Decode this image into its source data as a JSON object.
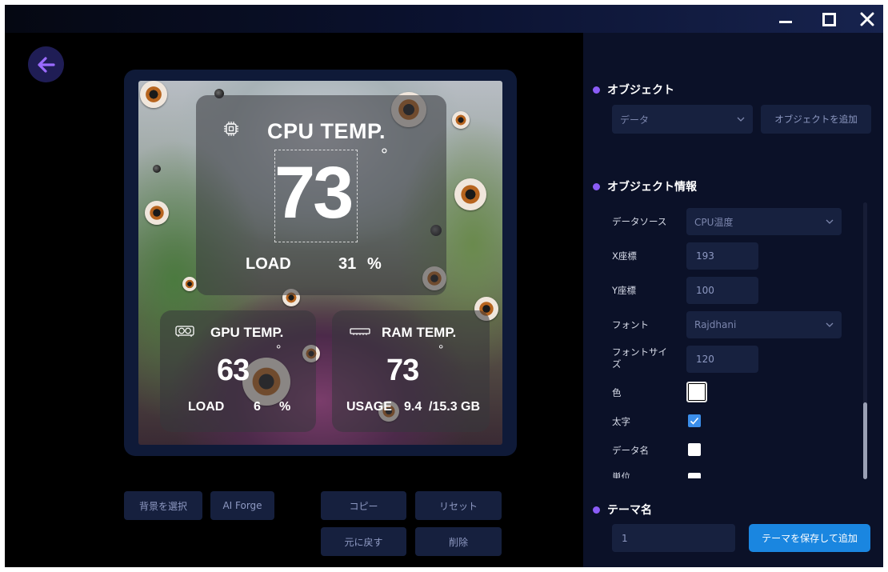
{
  "window": {
    "minimize_icon": "minimize-icon",
    "maximize_icon": "maximize-icon",
    "close_icon": "close-icon"
  },
  "back_icon": "arrow-left-icon",
  "preview": {
    "cpu": {
      "title": "CPU TEMP.",
      "value": "73",
      "unit": "°",
      "load_label": "LOAD",
      "load_value": "31",
      "load_unit": "%"
    },
    "gpu": {
      "title": "GPU TEMP.",
      "value": "63",
      "unit": "°",
      "load_label": "LOAD",
      "load_value": "6",
      "load_unit": "%"
    },
    "ram": {
      "title": "RAM TEMP.",
      "value": "73",
      "unit": "°",
      "usage_label": "USAGE",
      "usage_value": "9.4",
      "usage_total": "/15.3 GB"
    }
  },
  "buttons": {
    "select_bg": "背景を選択",
    "ai_forge": "AI Forge",
    "copy": "コピー",
    "reset": "リセット",
    "undo": "元に戻す",
    "delete": "削除"
  },
  "panel": {
    "object_section": "オブジェクト",
    "object_select": "データ",
    "add_object": "オブジェクトを追加",
    "info_section": "オブジェクト情報",
    "fields": {
      "data_source_label": "データソース",
      "data_source_value": "CPU温度",
      "x_label": "X座標",
      "x_value": "193",
      "y_label": "Y座標",
      "y_value": "100",
      "font_label": "フォント",
      "font_value": "Rajdhani",
      "font_size_label_1": "フォントサイ",
      "font_size_label_2": "ズ",
      "font_size_value": "120",
      "color_label": "色",
      "color_value": "#ffffff",
      "bold_label": "太字",
      "bold_checked": true,
      "data_name_label": "データ名",
      "data_name_checked": false,
      "unit_label": "単位"
    },
    "theme_section": "テーマ名",
    "theme_value": "1",
    "save_button": "テーマを保存して追加"
  },
  "colors": {
    "accent": "#8b5cf6",
    "primary_button": "#1a86e0",
    "panel_bg": "#0b1128",
    "checkbox_checked": "#3b8eea"
  }
}
